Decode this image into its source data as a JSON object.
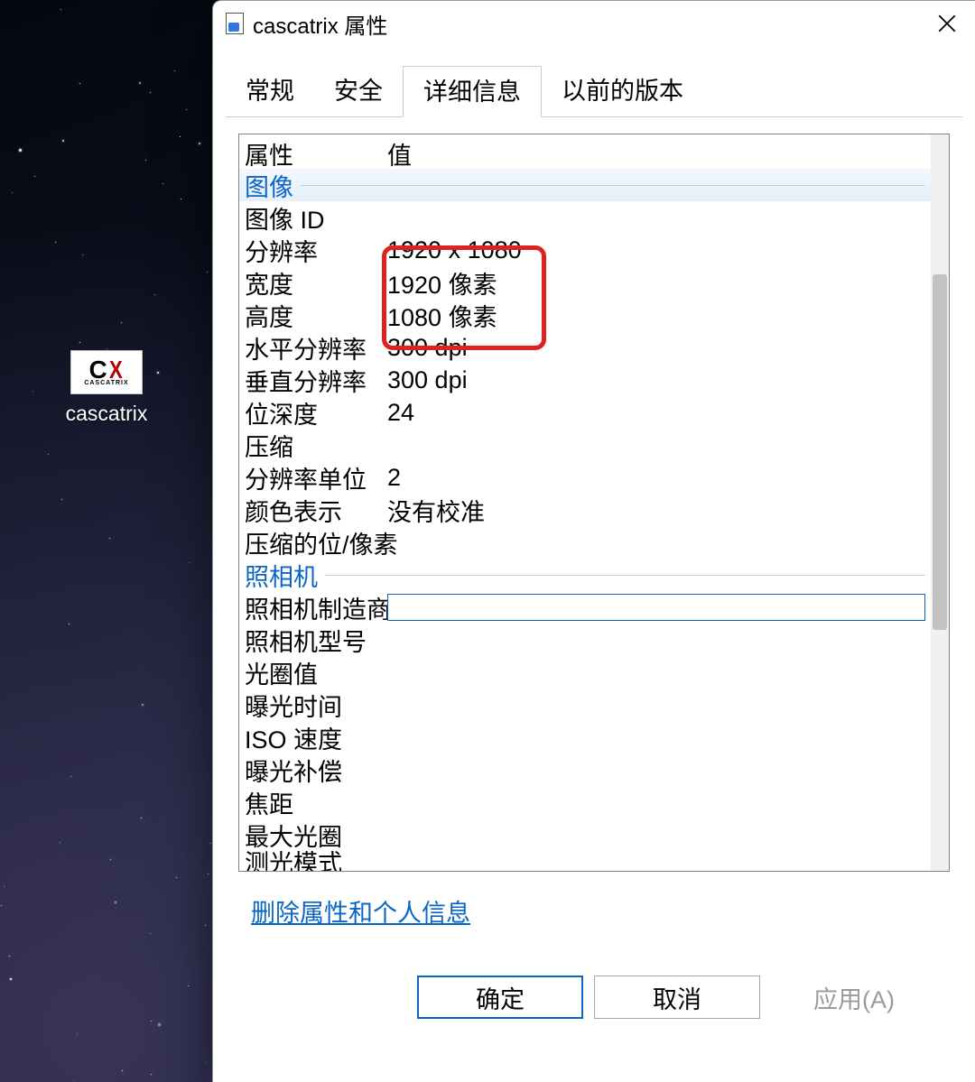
{
  "desktop": {
    "icon_label": "cascatrix",
    "logo_text": "CX",
    "logo_subtext": "CASCATRIX"
  },
  "dialog": {
    "title": "cascatrix 属性"
  },
  "tabs": {
    "general": "常规",
    "security": "安全",
    "details": "详细信息",
    "previous": "以前的版本"
  },
  "header": {
    "property": "属性",
    "value": "值"
  },
  "sections": {
    "image": "图像",
    "camera": "照相机"
  },
  "props": {
    "image_id": {
      "label": "图像 ID",
      "value": ""
    },
    "resolution": {
      "label": "分辨率",
      "value": "1920 x 1080"
    },
    "width": {
      "label": "宽度",
      "value": "1920 像素"
    },
    "height": {
      "label": "高度",
      "value": "1080 像素"
    },
    "h_dpi": {
      "label": "水平分辨率",
      "value": "300 dpi"
    },
    "v_dpi": {
      "label": "垂直分辨率",
      "value": "300 dpi"
    },
    "bit_depth": {
      "label": "位深度",
      "value": "24"
    },
    "compression": {
      "label": "压缩",
      "value": ""
    },
    "res_unit": {
      "label": "分辨率单位",
      "value": "2"
    },
    "color_rep": {
      "label": "颜色表示",
      "value": "没有校准"
    },
    "bpp": {
      "label": "压缩的位/像素",
      "value": ""
    },
    "cam_maker": {
      "label": "照相机制造商",
      "value": ""
    },
    "cam_model": {
      "label": "照相机型号",
      "value": ""
    },
    "fstop": {
      "label": "光圈值",
      "value": ""
    },
    "exposure": {
      "label": "曝光时间",
      "value": ""
    },
    "iso": {
      "label": "ISO 速度",
      "value": ""
    },
    "exp_bias": {
      "label": "曝光补偿",
      "value": ""
    },
    "focal": {
      "label": "焦距",
      "value": ""
    },
    "max_aperture": {
      "label": "最大光圈",
      "value": ""
    },
    "metering": {
      "label": "测光模式",
      "value": ""
    }
  },
  "link": {
    "remove_props": "删除属性和个人信息"
  },
  "buttons": {
    "ok": "确定",
    "cancel": "取消",
    "apply": "应用(A)"
  }
}
